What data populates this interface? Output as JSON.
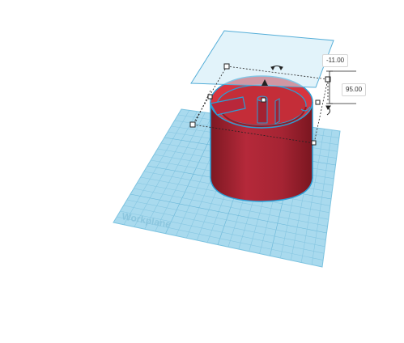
{
  "workplane": {
    "label": "Workplane"
  },
  "dimensions": {
    "elevation": "-11.00",
    "height": "95.00"
  },
  "icons": {
    "rotate_top": "rotate-arrow-icon",
    "rotate_side": "rotate-arrow-icon",
    "direction": "triangle-up-icon"
  },
  "colors": {
    "grid": "#9fd3ea",
    "grid_line": "#6ab7d8",
    "shape": "#c8303c",
    "shape_dark": "#8e1e28",
    "outline": "#2a9fd6"
  }
}
